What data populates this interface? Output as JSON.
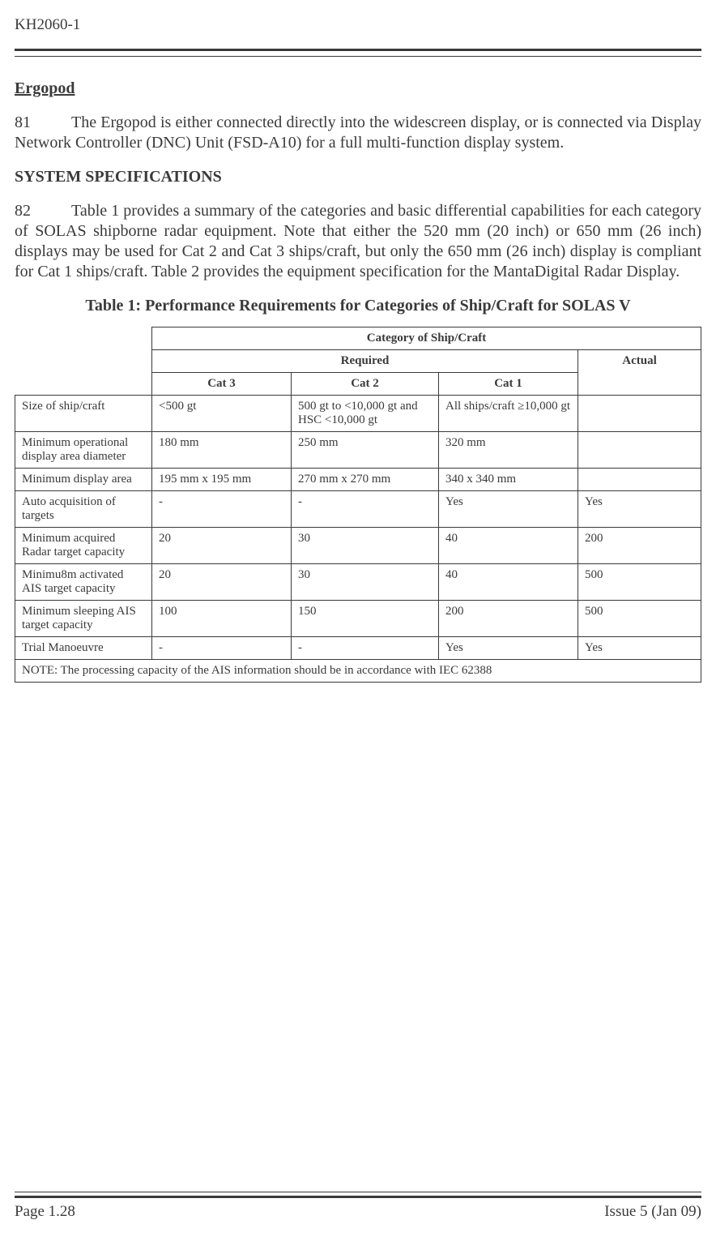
{
  "header": {
    "doc_id": "KH2060-1"
  },
  "sections": {
    "ergopod": {
      "title": "Ergopod",
      "para_num": "81",
      "text": "The Ergopod is either connected directly into the widescreen display, or is connected via Display Network Controller (DNC) Unit (FSD-A10) for a full multi-function display system."
    },
    "specs": {
      "heading": "SYSTEM SPECIFICATIONS",
      "para_num": "82",
      "text": "Table 1 provides a summary of the categories and basic differential capabilities for each category of SOLAS shipborne radar equipment. Note that either the 520 mm (20 inch) or 650 mm (26 inch) displays may be used for Cat 2 and Cat 3 ships/craft, but only the 650 mm (26 inch) display is compliant for Cat 1 ships/craft. Table 2 provides the equipment specification for the MantaDigital Radar Display."
    }
  },
  "table": {
    "caption": "Table 1: Performance Requirements for Categories of Ship/Craft for SOLAS V",
    "group_header": "Category of Ship/Craft",
    "sub_headers": {
      "required": "Required",
      "actual": "Actual"
    },
    "cat_headers": {
      "cat3": "Cat 3",
      "cat2": "Cat 2",
      "cat1": "Cat 1"
    },
    "rows": [
      {
        "label": "Size of ship/craft",
        "cat3": "<500 gt",
        "cat2": "500 gt to <10,000 gt and HSC <10,000 gt",
        "cat1": "All ships/craft ≥10,000 gt",
        "actual": ""
      },
      {
        "label": "Minimum operational display area diameter",
        "cat3": "180 mm",
        "cat2": "250 mm",
        "cat1": "320 mm",
        "actual": ""
      },
      {
        "label": "Minimum display area",
        "cat3": "195 mm x 195 mm",
        "cat2": "270 mm x 270 mm",
        "cat1": "340 x 340 mm",
        "actual": ""
      },
      {
        "label": "Auto acquisition of targets",
        "cat3": "-",
        "cat2": "-",
        "cat1": "Yes",
        "actual": "Yes"
      },
      {
        "label": "Minimum acquired Radar target capacity",
        "cat3": "20",
        "cat2": "30",
        "cat1": "40",
        "actual": "200"
      },
      {
        "label": "Minimu8m activated AIS target capacity",
        "cat3": "20",
        "cat2": "30",
        "cat1": "40",
        "actual": "500"
      },
      {
        "label": "Minimum sleeping AIS target capacity",
        "cat3": "100",
        "cat2": "150",
        "cat1": "200",
        "actual": "500"
      },
      {
        "label": "Trial Manoeuvre",
        "cat3": "-",
        "cat2": "-",
        "cat1": "Yes",
        "actual": "Yes"
      }
    ],
    "note": "NOTE: The processing capacity of the AIS information should be in accordance with IEC 62388"
  },
  "footer": {
    "page": "Page 1.28",
    "issue": "Issue 5 (Jan 09)"
  }
}
